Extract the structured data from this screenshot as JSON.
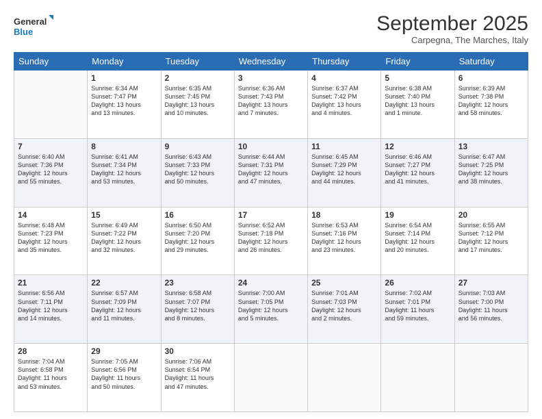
{
  "header": {
    "logo_line1": "General",
    "logo_line2": "Blue",
    "month": "September 2025",
    "location": "Carpegna, The Marches, Italy"
  },
  "weekdays": [
    "Sunday",
    "Monday",
    "Tuesday",
    "Wednesday",
    "Thursday",
    "Friday",
    "Saturday"
  ],
  "weeks": [
    [
      {
        "day": "",
        "text": ""
      },
      {
        "day": "1",
        "text": "Sunrise: 6:34 AM\nSunset: 7:47 PM\nDaylight: 13 hours\nand 13 minutes."
      },
      {
        "day": "2",
        "text": "Sunrise: 6:35 AM\nSunset: 7:45 PM\nDaylight: 13 hours\nand 10 minutes."
      },
      {
        "day": "3",
        "text": "Sunrise: 6:36 AM\nSunset: 7:43 PM\nDaylight: 13 hours\nand 7 minutes."
      },
      {
        "day": "4",
        "text": "Sunrise: 6:37 AM\nSunset: 7:42 PM\nDaylight: 13 hours\nand 4 minutes."
      },
      {
        "day": "5",
        "text": "Sunrise: 6:38 AM\nSunset: 7:40 PM\nDaylight: 13 hours\nand 1 minute."
      },
      {
        "day": "6",
        "text": "Sunrise: 6:39 AM\nSunset: 7:38 PM\nDaylight: 12 hours\nand 58 minutes."
      }
    ],
    [
      {
        "day": "7",
        "text": "Sunrise: 6:40 AM\nSunset: 7:36 PM\nDaylight: 12 hours\nand 55 minutes."
      },
      {
        "day": "8",
        "text": "Sunrise: 6:41 AM\nSunset: 7:34 PM\nDaylight: 12 hours\nand 53 minutes."
      },
      {
        "day": "9",
        "text": "Sunrise: 6:43 AM\nSunset: 7:33 PM\nDaylight: 12 hours\nand 50 minutes."
      },
      {
        "day": "10",
        "text": "Sunrise: 6:44 AM\nSunset: 7:31 PM\nDaylight: 12 hours\nand 47 minutes."
      },
      {
        "day": "11",
        "text": "Sunrise: 6:45 AM\nSunset: 7:29 PM\nDaylight: 12 hours\nand 44 minutes."
      },
      {
        "day": "12",
        "text": "Sunrise: 6:46 AM\nSunset: 7:27 PM\nDaylight: 12 hours\nand 41 minutes."
      },
      {
        "day": "13",
        "text": "Sunrise: 6:47 AM\nSunset: 7:25 PM\nDaylight: 12 hours\nand 38 minutes."
      }
    ],
    [
      {
        "day": "14",
        "text": "Sunrise: 6:48 AM\nSunset: 7:23 PM\nDaylight: 12 hours\nand 35 minutes."
      },
      {
        "day": "15",
        "text": "Sunrise: 6:49 AM\nSunset: 7:22 PM\nDaylight: 12 hours\nand 32 minutes."
      },
      {
        "day": "16",
        "text": "Sunrise: 6:50 AM\nSunset: 7:20 PM\nDaylight: 12 hours\nand 29 minutes."
      },
      {
        "day": "17",
        "text": "Sunrise: 6:52 AM\nSunset: 7:18 PM\nDaylight: 12 hours\nand 26 minutes."
      },
      {
        "day": "18",
        "text": "Sunrise: 6:53 AM\nSunset: 7:16 PM\nDaylight: 12 hours\nand 23 minutes."
      },
      {
        "day": "19",
        "text": "Sunrise: 6:54 AM\nSunset: 7:14 PM\nDaylight: 12 hours\nand 20 minutes."
      },
      {
        "day": "20",
        "text": "Sunrise: 6:55 AM\nSunset: 7:12 PM\nDaylight: 12 hours\nand 17 minutes."
      }
    ],
    [
      {
        "day": "21",
        "text": "Sunrise: 6:56 AM\nSunset: 7:11 PM\nDaylight: 12 hours\nand 14 minutes."
      },
      {
        "day": "22",
        "text": "Sunrise: 6:57 AM\nSunset: 7:09 PM\nDaylight: 12 hours\nand 11 minutes."
      },
      {
        "day": "23",
        "text": "Sunrise: 6:58 AM\nSunset: 7:07 PM\nDaylight: 12 hours\nand 8 minutes."
      },
      {
        "day": "24",
        "text": "Sunrise: 7:00 AM\nSunset: 7:05 PM\nDaylight: 12 hours\nand 5 minutes."
      },
      {
        "day": "25",
        "text": "Sunrise: 7:01 AM\nSunset: 7:03 PM\nDaylight: 12 hours\nand 2 minutes."
      },
      {
        "day": "26",
        "text": "Sunrise: 7:02 AM\nSunset: 7:01 PM\nDaylight: 11 hours\nand 59 minutes."
      },
      {
        "day": "27",
        "text": "Sunrise: 7:03 AM\nSunset: 7:00 PM\nDaylight: 11 hours\nand 56 minutes."
      }
    ],
    [
      {
        "day": "28",
        "text": "Sunrise: 7:04 AM\nSunset: 6:58 PM\nDaylight: 11 hours\nand 53 minutes."
      },
      {
        "day": "29",
        "text": "Sunrise: 7:05 AM\nSunset: 6:56 PM\nDaylight: 11 hours\nand 50 minutes."
      },
      {
        "day": "30",
        "text": "Sunrise: 7:06 AM\nSunset: 6:54 PM\nDaylight: 11 hours\nand 47 minutes."
      },
      {
        "day": "",
        "text": ""
      },
      {
        "day": "",
        "text": ""
      },
      {
        "day": "",
        "text": ""
      },
      {
        "day": "",
        "text": ""
      }
    ]
  ]
}
